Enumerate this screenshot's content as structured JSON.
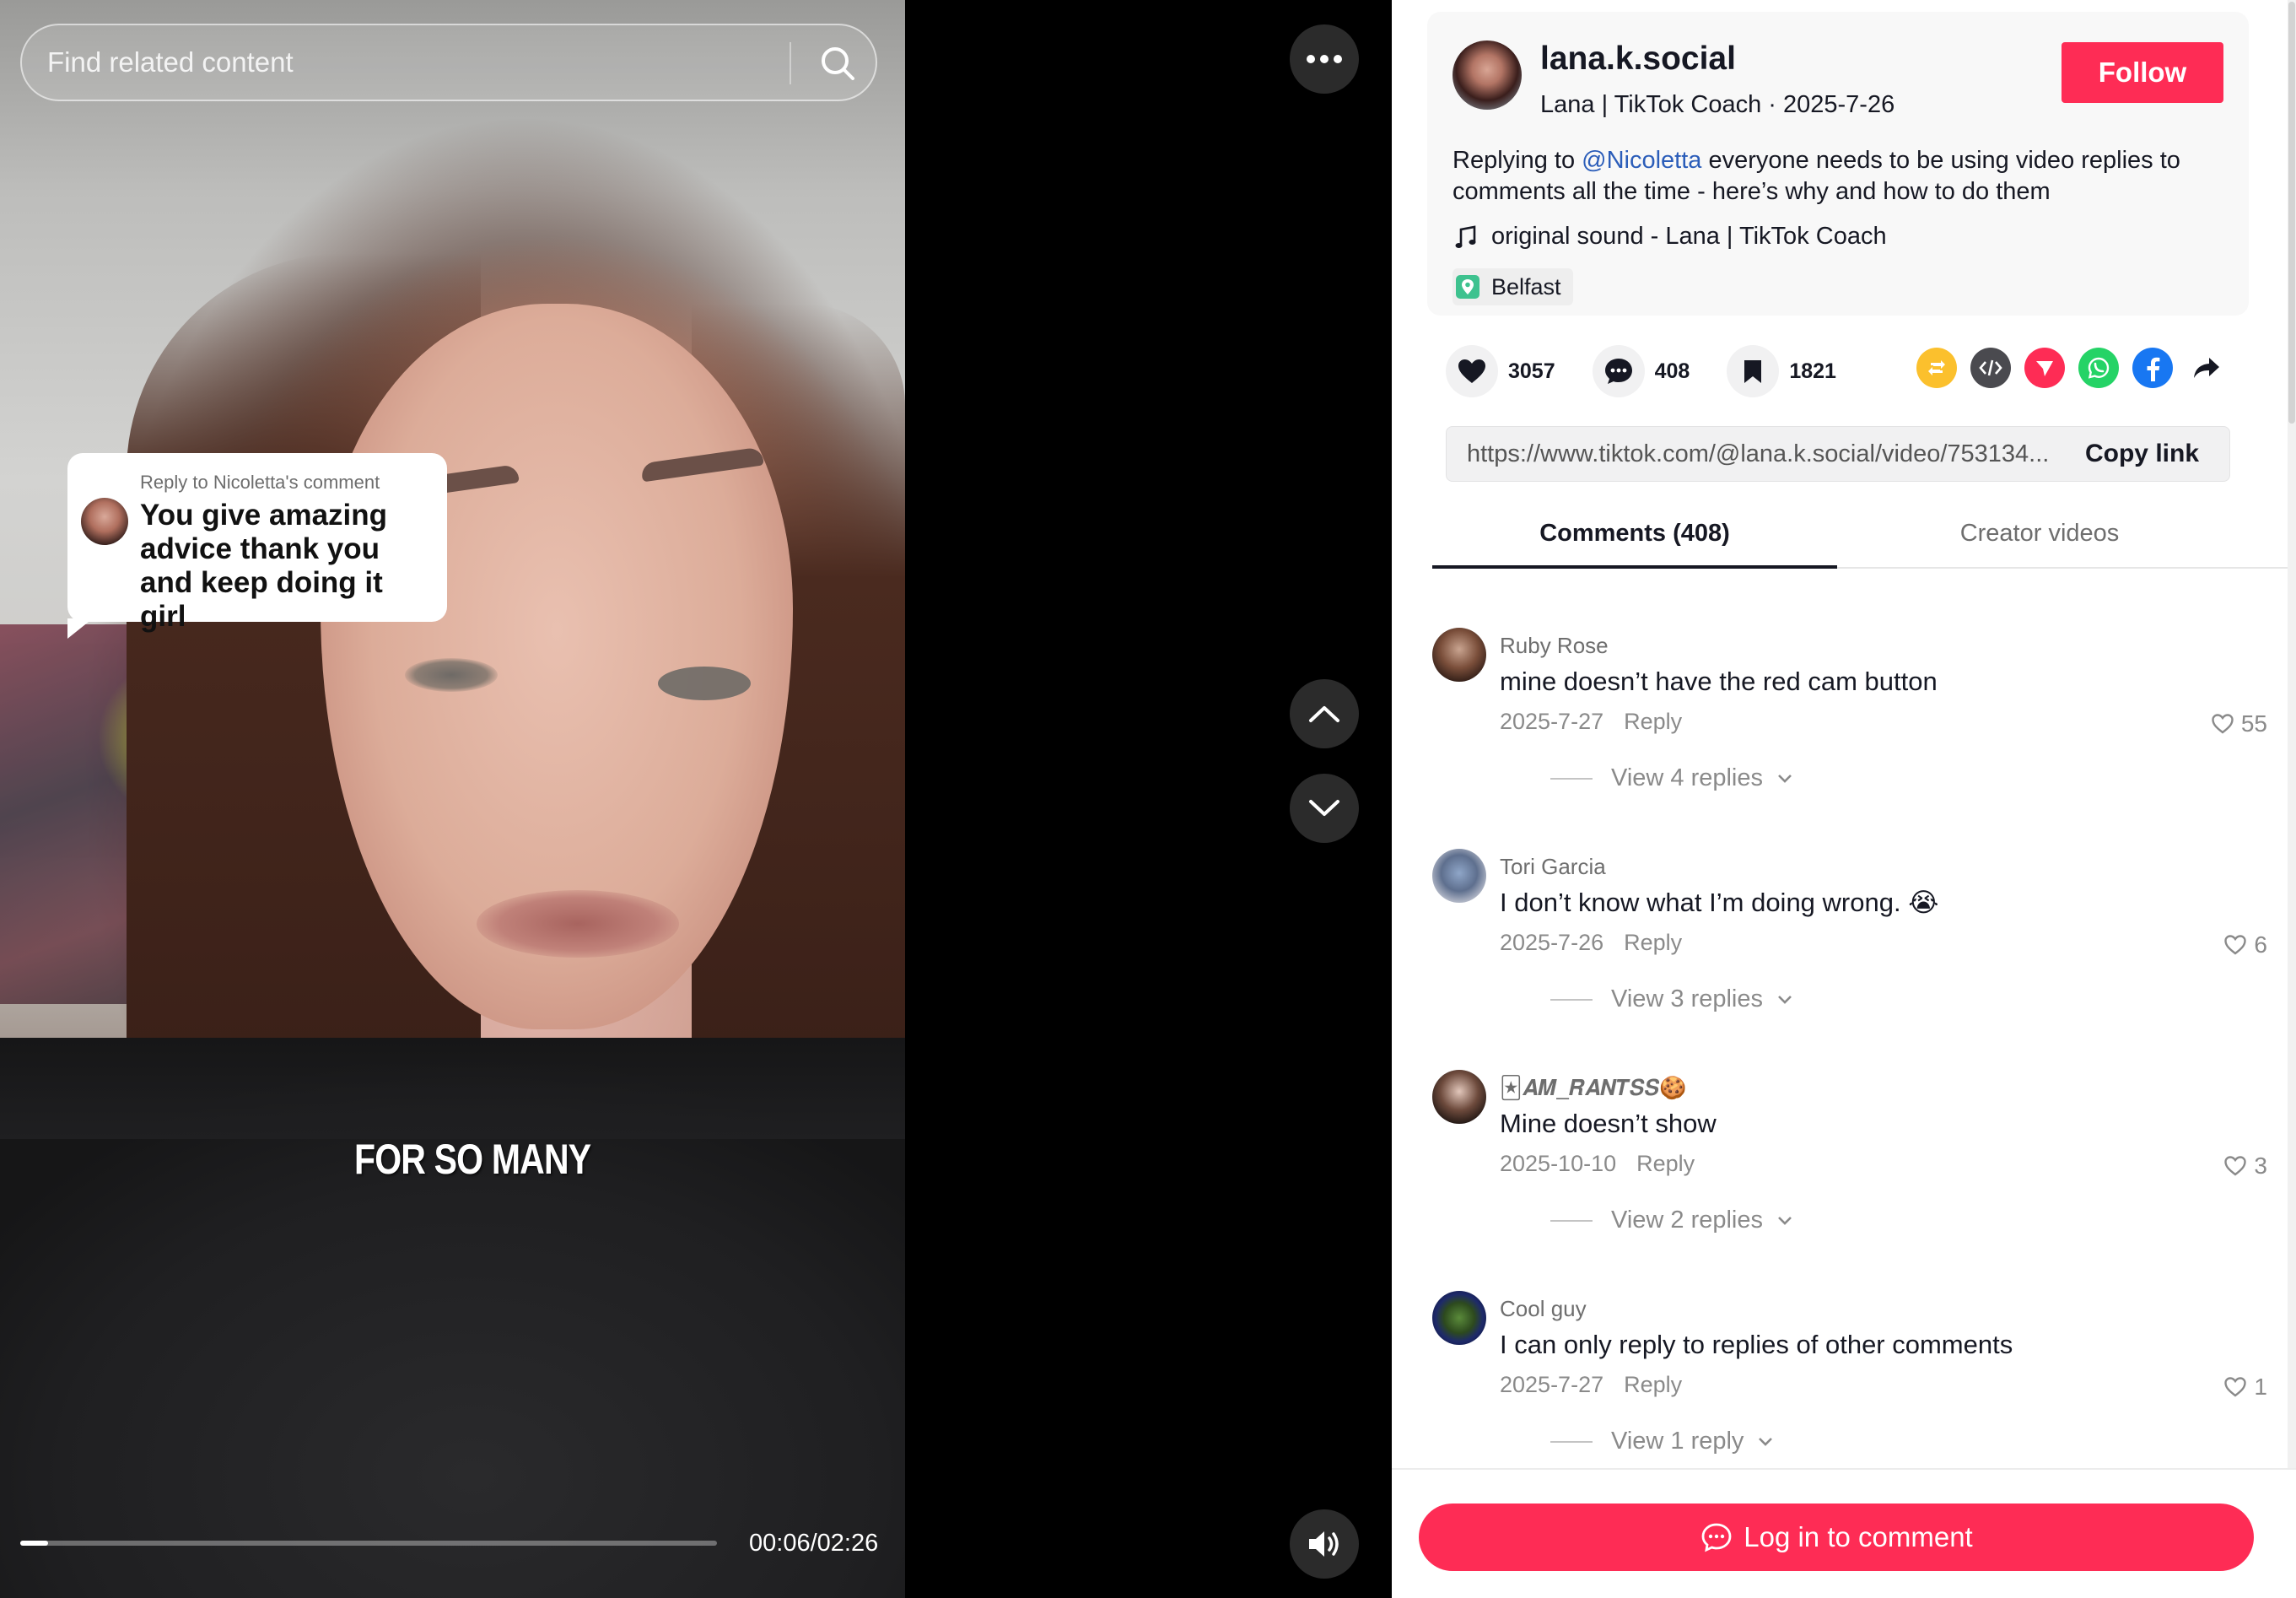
{
  "search": {
    "placeholder": "Find related content"
  },
  "video": {
    "reply_label": "Reply to Nicoletta's comment",
    "reply_text": "You give amazing advice thank you and keep doing it girl",
    "caption": "FOR SO MANY",
    "time": "00:06/02:26",
    "progress": 0.04
  },
  "creator": {
    "username": "lana.k.social",
    "subtitle": "Lana | TikTok Coach · 2025-7-26",
    "follow_label": "Follow",
    "desc_prefix": "Replying to ",
    "desc_mention": "@Nicoletta",
    "desc_rest": " everyone needs to be using video replies to comments all the time - here’s why and how to do them",
    "sound": "original sound - Lana | TikTok Coach",
    "location": "Belfast"
  },
  "stats": {
    "likes": "3057",
    "comments": "408",
    "saves": "1821"
  },
  "share_icons": [
    "repost-icon",
    "embed-icon",
    "send-icon",
    "whatsapp-icon",
    "facebook-icon",
    "share-arrow-icon"
  ],
  "link": {
    "url": "https://www.tiktok.com/@lana.k.social/video/753134...",
    "copy_label": "Copy link"
  },
  "tabs": {
    "comments": "Comments (408)",
    "creator": "Creator videos"
  },
  "comments": [
    {
      "user": "Ruby Rose",
      "text": "mine doesn’t have the red cam button",
      "date": "2025-7-27",
      "reply": "Reply",
      "likes": "55",
      "replies": "View 4 replies"
    },
    {
      "user": "Tori Garcia",
      "text": "I don’t know what I’m doing wrong. 😭",
      "date": "2025-7-26",
      "reply": "Reply",
      "likes": "6",
      "replies": "View 3 replies"
    },
    {
      "user": "🃏𝑨𝑴_𝑹𝑨𝑵𝑻𝑺𝑺🍪",
      "text": "Mine doesn’t show",
      "date": "2025-10-10",
      "reply": "Reply",
      "likes": "3",
      "replies": "View 2 replies"
    },
    {
      "user": "Cool guy",
      "text": "I can only reply to replies of other comments",
      "date": "2025-7-27",
      "reply": "Reply",
      "likes": "1",
      "replies": "View 1 reply"
    }
  ],
  "login": {
    "label": "Log in to comment"
  },
  "colors": {
    "accent": "#fe2c55",
    "mention": "#2b5db9",
    "panel_bg": "#ffffff"
  }
}
